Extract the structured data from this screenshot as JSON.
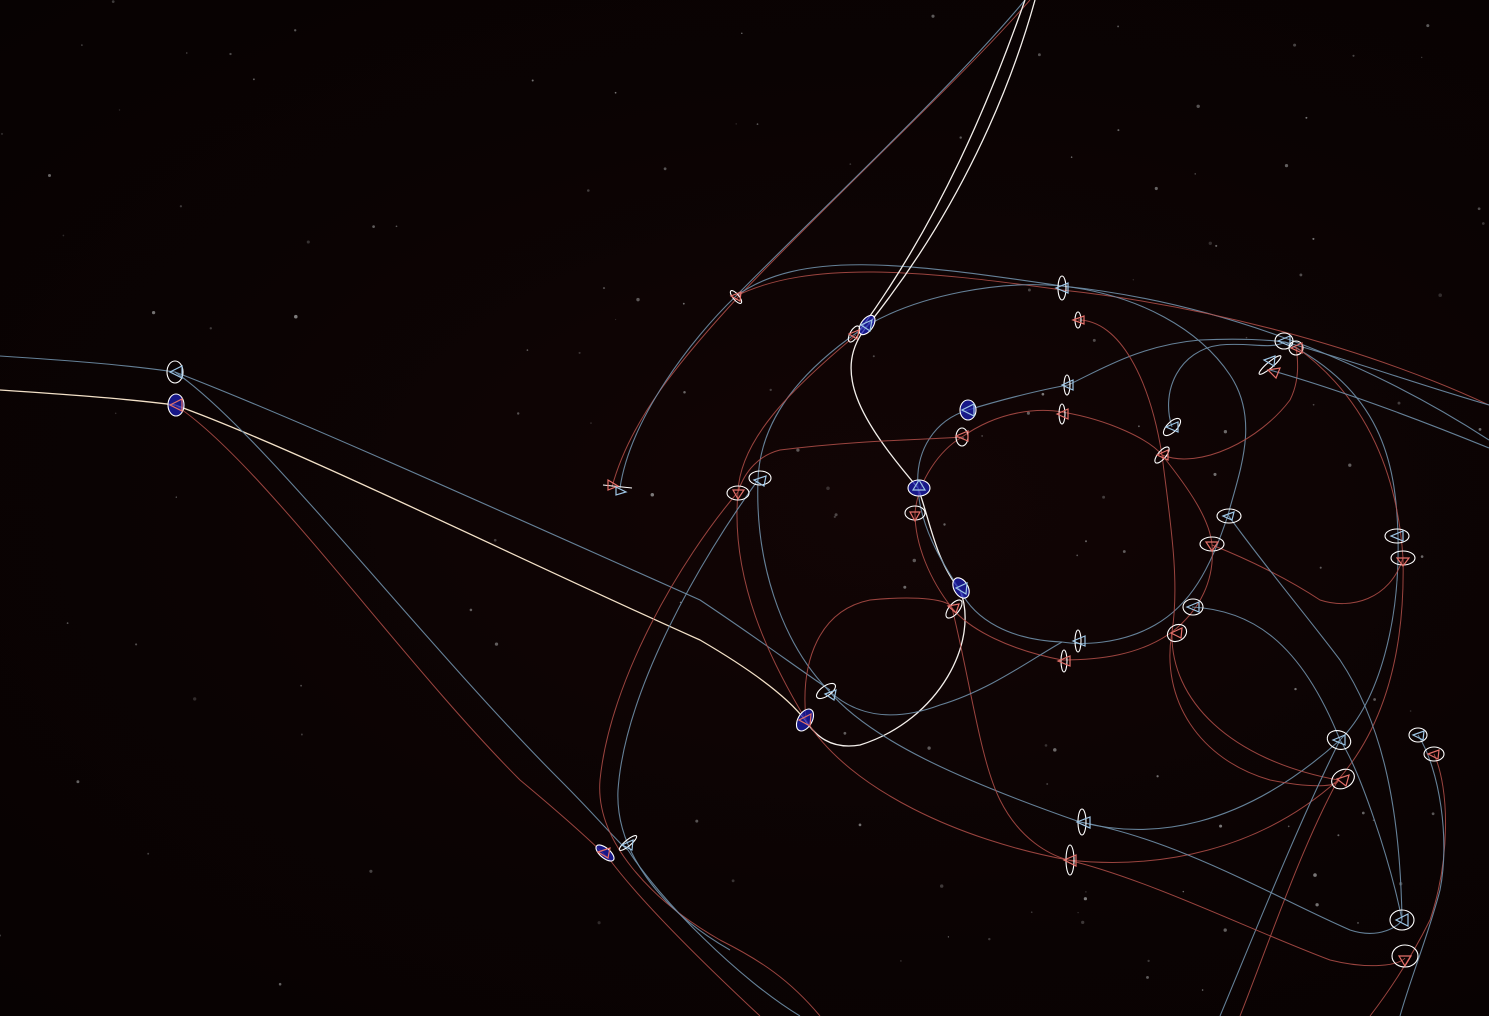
{
  "scene": {
    "background_color": "#0a0303",
    "trail_colors": {
      "blue_team": "#6f8fa8",
      "red_team": "#b4504a",
      "highlight": "#f4f0ec"
    },
    "marker_colors": {
      "ring": "#ffffff",
      "selected_fill": "#1b1fb4",
      "blue_ship": "#9ec6e6",
      "red_ship": "#e4706a"
    },
    "icons": [
      "ship-marker-icon",
      "orbit-ring-icon",
      "star-icon"
    ]
  }
}
